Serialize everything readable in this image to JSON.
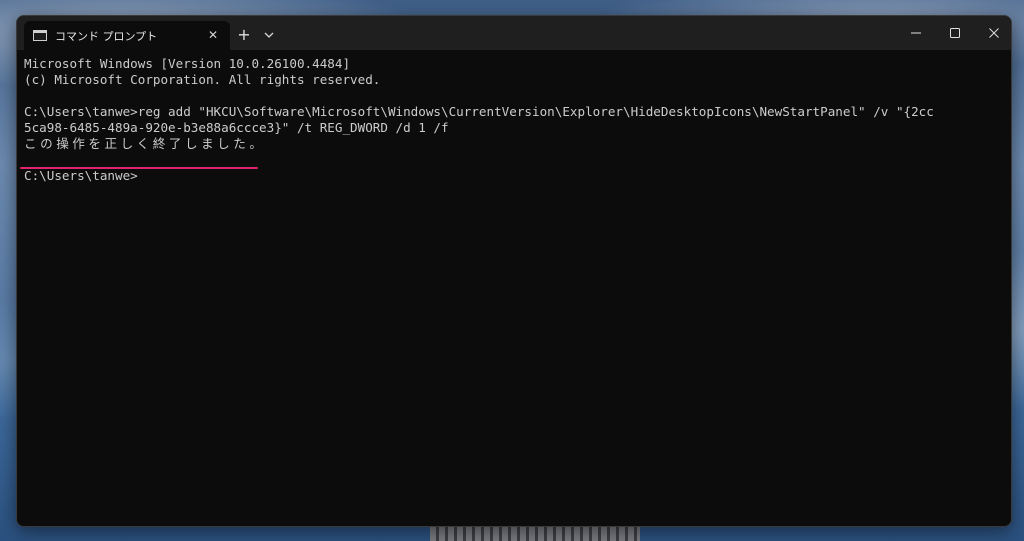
{
  "window": {
    "tab_title": "コマンド プロンプト",
    "tab_close_glyph": "✕",
    "new_tab_glyph": "+",
    "tab_icon": "terminal-icon",
    "dropdown_icon": "chevron-down-icon",
    "minimize_icon": "minimize-icon",
    "maximize_icon": "maximize-icon",
    "close_icon": "close-icon"
  },
  "terminal": {
    "lines": [
      "Microsoft Windows [Version 10.0.26100.4484]",
      "(c) Microsoft Corporation. All rights reserved.",
      "",
      "C:\\Users\\tanwe>reg add \"HKCU\\Software\\Microsoft\\Windows\\CurrentVersion\\Explorer\\HideDesktopIcons\\NewStartPanel\" /v \"{2cc",
      "5ca98-6485-489a-920e-b3e88a6ccce3}\" /t REG_DWORD /d 1 /f",
      "この操作を正しく終了しました。",
      "",
      "C:\\Users\\tanwe>"
    ],
    "highlight_color": "#e0246e"
  }
}
